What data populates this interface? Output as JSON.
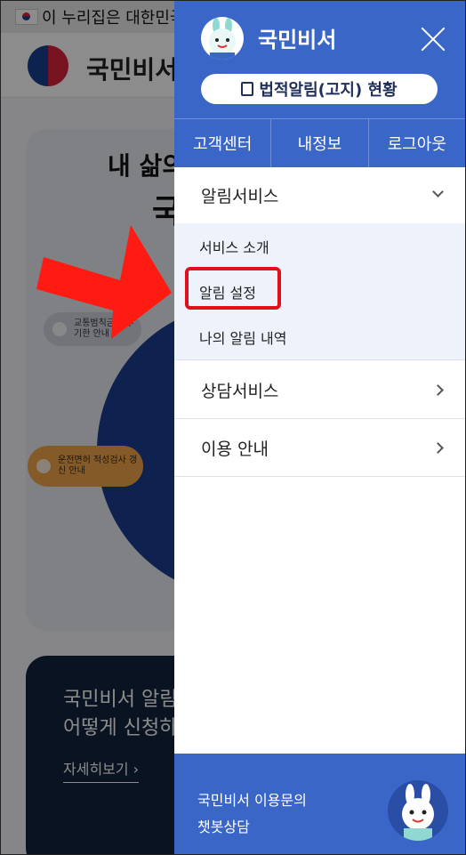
{
  "background": {
    "banner_text": "이 누리집은 대한민국",
    "header_title": "국민비서",
    "hero_line1": "내 삶의",
    "hero_line2": "국",
    "pill_traffic": "교통범칙금 납부기한 안내",
    "pill_license": "운전면허 적성검사 갱신 안내",
    "dark_title_1": "국민비서 알림",
    "dark_title_2": "어떻게 신청하",
    "dark_link": "자세히보기 ›"
  },
  "drawer": {
    "brand": "국민비서",
    "legal_button": "법적알림(고지) 현황",
    "quick_nav": [
      "고객센터",
      "내정보",
      "로그아웃"
    ],
    "sections": [
      {
        "label": "알림서비스",
        "expanded": true,
        "items": [
          "서비스 소개",
          "알림 설정",
          "나의 알림 내역"
        ]
      },
      {
        "label": "상담서비스",
        "expanded": false
      },
      {
        "label": "이용 안내",
        "expanded": false
      }
    ],
    "footer_line1": "국민비서 이용문의",
    "footer_line2": "챗봇상담"
  },
  "annotation": {
    "highlighted_item": "알림 설정",
    "arrow_color": "#ff1a12",
    "box_color": "#e0101a"
  },
  "colors": {
    "brand_blue": "#3a66c8",
    "submenu_bg": "#eef3fb"
  }
}
